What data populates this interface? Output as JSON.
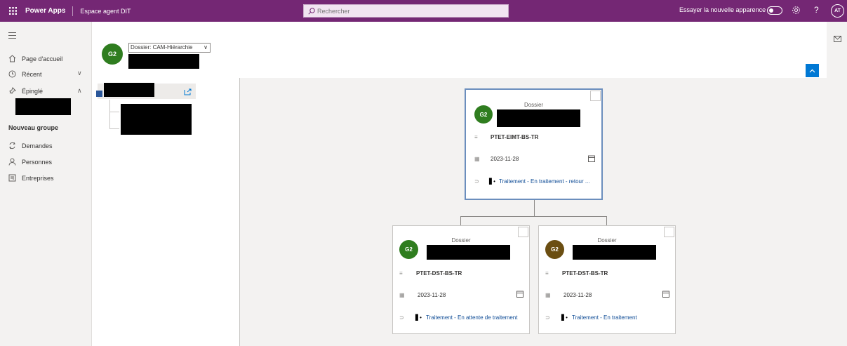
{
  "topbar": {
    "app_name": "Power Apps",
    "environment": "Espace agent DIT",
    "search_placeholder": "Rechercher",
    "try_new_look": "Essayer la nouvelle apparence",
    "help": "?",
    "user_initials": "AT"
  },
  "nav": {
    "home": "Page d'accueil",
    "recent": "Récent",
    "pinned": "Épinglé",
    "group_label": "Nouveau groupe",
    "items": [
      {
        "label": "Demandes",
        "icon": "requests-icon"
      },
      {
        "label": "Personnes",
        "icon": "person-icon"
      },
      {
        "label": "Entreprises",
        "icon": "company-icon"
      }
    ]
  },
  "header": {
    "avatar_initials": "G2",
    "view_selector": "Dossier: CAM-Hiérarchie"
  },
  "cards": {
    "root": {
      "type": "Dossier",
      "initials": "G2",
      "avatar_color": "#2f7d1f",
      "code": "PTET-EIMT-BS-TR",
      "date": "2023-11-28",
      "status": "Traitement - En traitement - retour ..."
    },
    "child1": {
      "type": "Dossier",
      "initials": "G2",
      "avatar_color": "#2f7d1f",
      "code": "PTET-DST-BS-TR",
      "date": "2023-11-28",
      "status": "Traitement - En attente de traitement"
    },
    "child2": {
      "type": "Dossier",
      "initials": "G2",
      "avatar_color": "#6b4e12",
      "code": "PTET-DST-BS-TR",
      "date": "2023-11-28",
      "status": "Traitement - En traitement"
    }
  },
  "colors": {
    "topbar": "#742774",
    "accent_blue": "#0078d4",
    "link": "#0f4c96"
  }
}
